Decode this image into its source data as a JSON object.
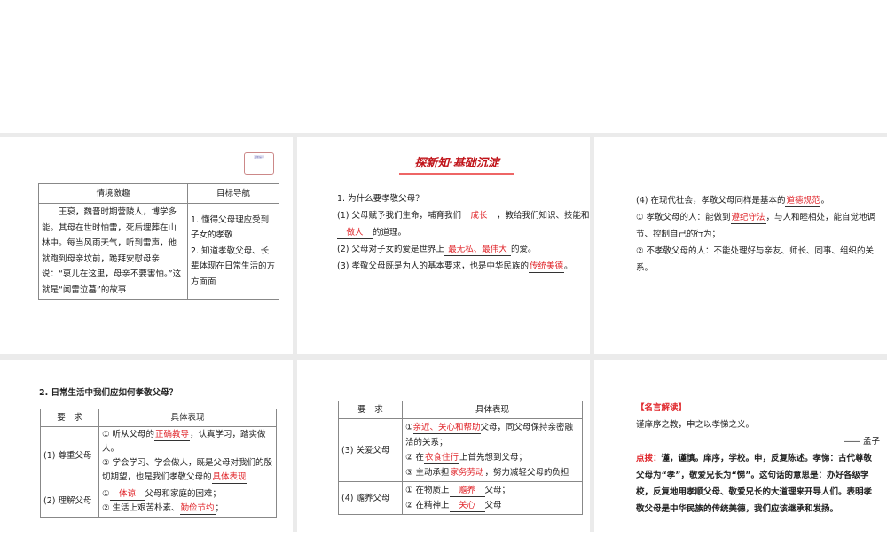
{
  "slide1": {
    "note": "温馨提示",
    "headers": [
      "情境激趣",
      "目标导航"
    ],
    "story": "王裒，魏晋时期营陵人，博学多能。其母在世时怕雷，死后埋葬在山林中。每当风雨天气，听到雷声，他就跑到母亲坟前，跪拜安慰母亲说：“裒儿在这里，母亲不要害怕。”这就是“闻雷泣墓”的故事",
    "goals": [
      "1. 懂得父母理应受到子女的孝敬",
      "2. 知道孝敬父母、长辈体现在日常生活的方方面面"
    ]
  },
  "slide2": {
    "banner": "探新知·基础沉淀",
    "q": "1. 为什么要孝敬父母？",
    "l1a": "(1) 父母赋予我们生命，哺育我们",
    "a1": "成长",
    "l1b": "，教给我们知识、技能和",
    "a2": "做人",
    "l1c": "的道理。",
    "l2a": "(2) 父母对子女的爱是世界上",
    "a3": "最无私、最伟大",
    "l2b": "的爱。",
    "l3a": "(3) 孝敬父母既是为人的基本要求，也是中华民族的",
    "a4": "传统美德",
    "l3b": "。"
  },
  "slide3": {
    "l1a": "(4) 在现代社会，孝敬父母同样是基本的",
    "a1": "道德规范",
    "l1b": "。",
    "l2a": "① 孝敬父母的人：能做到",
    "a2": "遵纪守法",
    "l2b": "，与人和睦相处，能自觉地调节、控制自己的行为；",
    "l3": "② 不孝敬父母的人：不能处理好与亲友、师长、同事、组织的关系。"
  },
  "slide4": {
    "q": "2. 日常生活中我们应如何孝敬父母？",
    "headers": [
      "要　求",
      "具体表现"
    ],
    "r1": "(1) 尊重父母",
    "r1a": "① 听从父母的",
    "r1b": "正确教导",
    "r1c": "，认真学习，踏实做人。",
    "r1d": "② 学会学习、学会做人，既是父母对我们的殷切期望，也是我们孝敬父母的",
    "r1e": "具体表现",
    "r2": "(2) 理解父母",
    "r2a": "①",
    "r2b": "体谅",
    "r2c": "父母和家庭的困难；",
    "r2d": "② 生活上艰苦朴素、",
    "r2e": "勤俭节约",
    "r2f": "；"
  },
  "slide5": {
    "headers": [
      "要　求",
      "具体表现"
    ],
    "r3": "(3) 关爱父母",
    "a": "①",
    "b": "亲近、关心和帮助",
    "c": "父母，同父母保持亲密融洽的关系；",
    "d": "② 在",
    "e": "衣食住行",
    "f": "上首先想到父母；",
    "g": "③ 主动承担",
    "h": "家务劳动",
    "i": "，努力减轻父母的负担",
    "r4": "(4) 赡养父母",
    "j": "① 在物质上",
    "k": "赡养",
    "l": "父母；",
    "m": "② 在精神上",
    "n": "关心",
    "o": "父母"
  },
  "slide6": {
    "title": "【名言解读】",
    "quote": "谨庠序之教，申之以孝悌之义。",
    "author": "—— 孟子",
    "label": "点拨：",
    "text": "谨，谨慎。庠序，学校。申，反复陈述。孝悌：古代尊敬父母为“孝”，敬爱兄长为“悌”。这句话的意思是：办好各级学校，反复地用孝顺父母、敬爱兄长的大道理来开导人们。表明孝敬父母是中华民族的传统美德，我们应该继承和发扬。"
  }
}
